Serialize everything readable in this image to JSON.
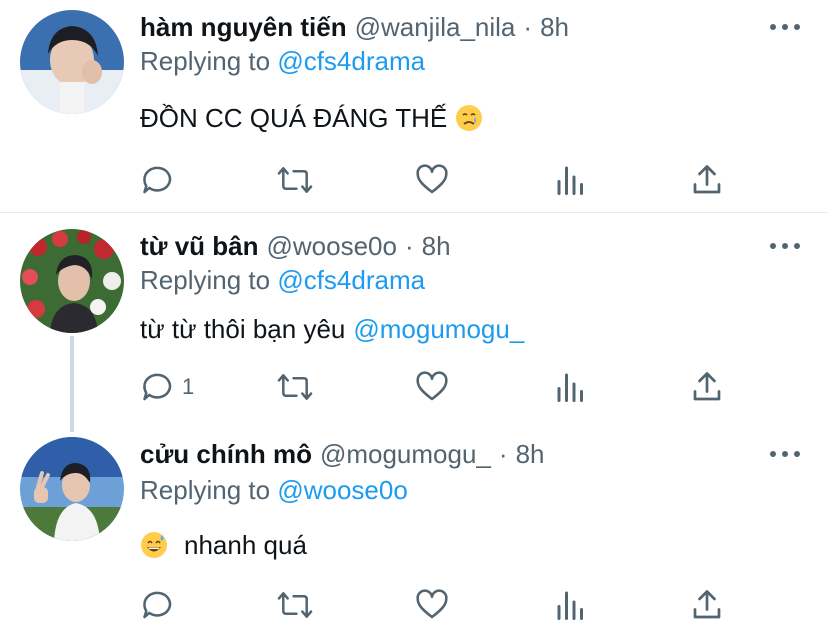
{
  "tweets": [
    {
      "name": "hàm nguyên tiến",
      "handle": "@wanjila_nila",
      "dot": "·",
      "time": "8h",
      "replying_prefix": "Replying to",
      "replying_to": "@cfs4drama",
      "text": "ĐỒN CC QUÁ ĐÁNG THẾ",
      "emoji": "crying-face-emoji",
      "reply_count": ""
    },
    {
      "name": "từ vũ bân",
      "handle": "@woose0o",
      "dot": "·",
      "time": "8h",
      "replying_prefix": "Replying to",
      "replying_to": "@cfs4drama",
      "text": "từ từ thôi bạn yêu",
      "mention": "@mogumogu_",
      "reply_count": "1"
    },
    {
      "name": "cửu chính mô",
      "handle": "@mogumogu_",
      "dot": "·",
      "time": "8h",
      "replying_prefix": "Replying to",
      "replying_to": "@woose0o",
      "text": "nhanh quá",
      "emoji": "grinning-sweat-emoji",
      "reply_count": ""
    }
  ],
  "colors": {
    "link": "#1d9bf0",
    "secondary_text": "#536471",
    "primary_text": "#0f1419",
    "divider": "#e6ecf0"
  }
}
